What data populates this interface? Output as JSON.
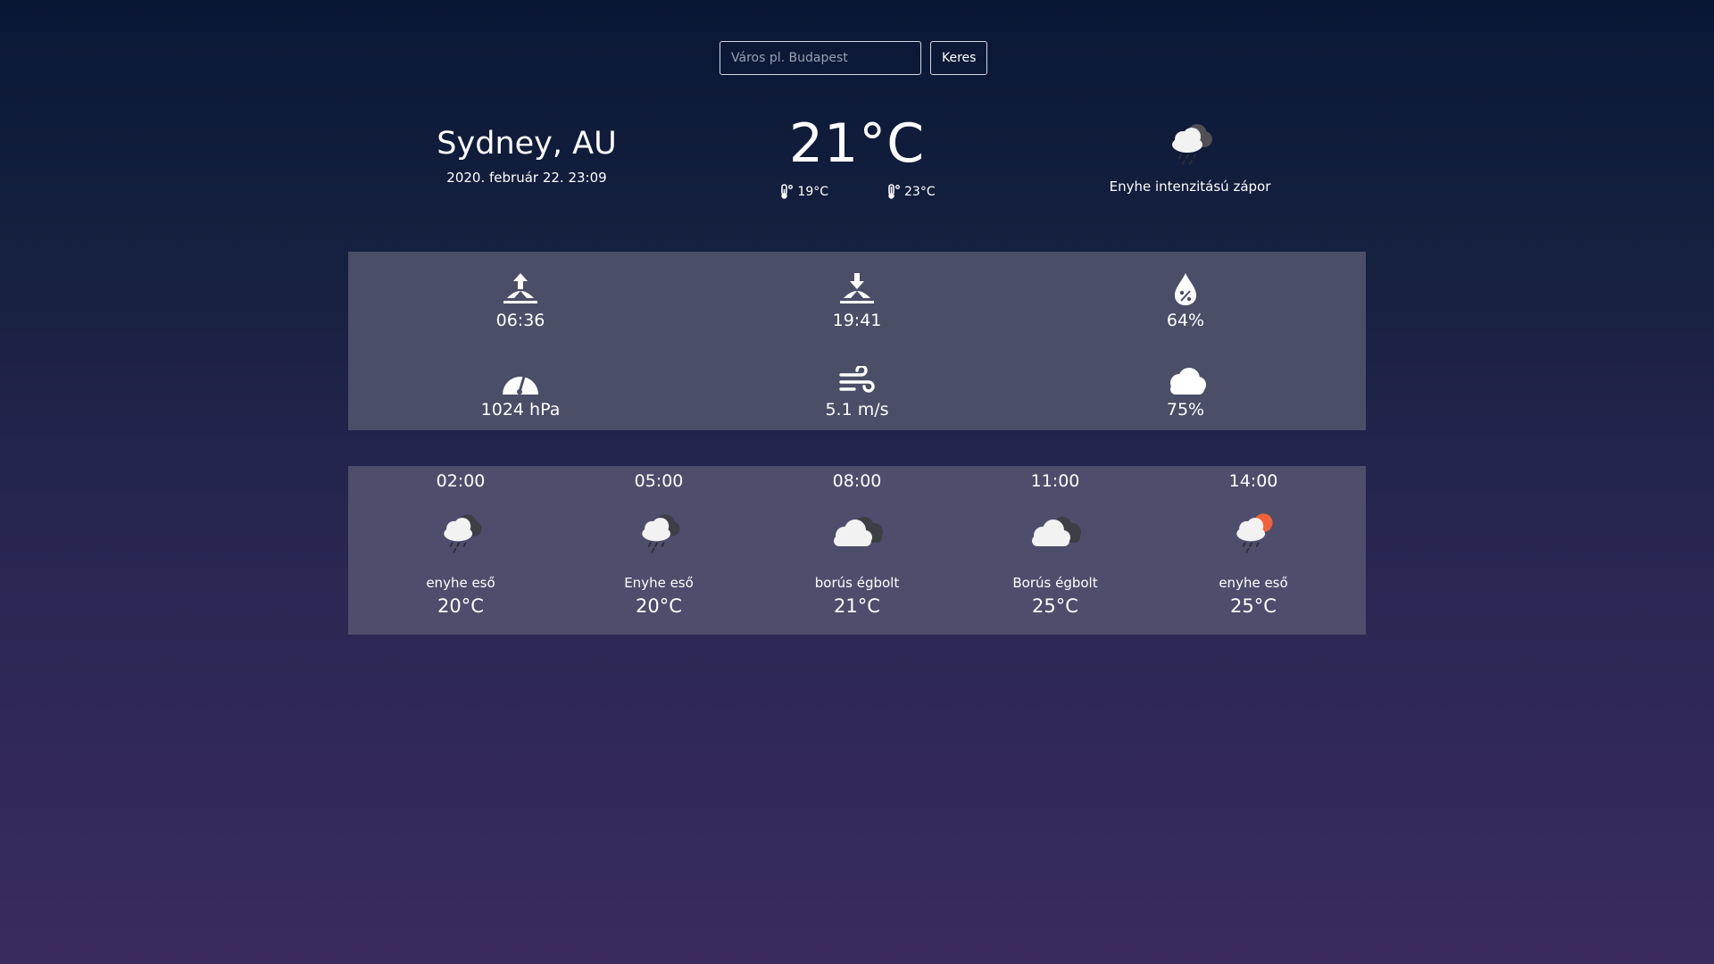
{
  "search": {
    "placeholder": "Város pl. Budapest",
    "value": "",
    "button_label": "Keres"
  },
  "current": {
    "location": "Sydney, AU",
    "datetime": "2020. február 22. 23:09",
    "temperature": "21°C",
    "temp_min": "19°C",
    "temp_max": "23°C",
    "condition": "Enyhe intenzitású zápor",
    "condition_icon": "cloud-rain-icon"
  },
  "details": {
    "sunrise": "06:36",
    "sunset": "19:41",
    "humidity": "64%",
    "pressure": "1024 hPa",
    "wind": "5.1 m/s",
    "clouds": "75%"
  },
  "forecast": [
    {
      "time": "02:00",
      "desc": "enyhe eső",
      "temp": "20°C",
      "icon": "cloud-rain-icon"
    },
    {
      "time": "05:00",
      "desc": "Enyhe eső",
      "temp": "20°C",
      "icon": "cloud-rain-icon"
    },
    {
      "time": "08:00",
      "desc": "borús égbolt",
      "temp": "21°C",
      "icon": "overcast-icon"
    },
    {
      "time": "11:00",
      "desc": "Borús égbolt",
      "temp": "25°C",
      "icon": "overcast-icon"
    },
    {
      "time": "14:00",
      "desc": "enyhe eső",
      "temp": "25°C",
      "icon": "sun-rain-icon"
    }
  ],
  "colors": {
    "background_top": "#091634",
    "background_bottom": "#3a2b5d",
    "panel": "#4a4e67",
    "forecast_panel": "#4e4d6c",
    "sun": "#f2623a"
  }
}
